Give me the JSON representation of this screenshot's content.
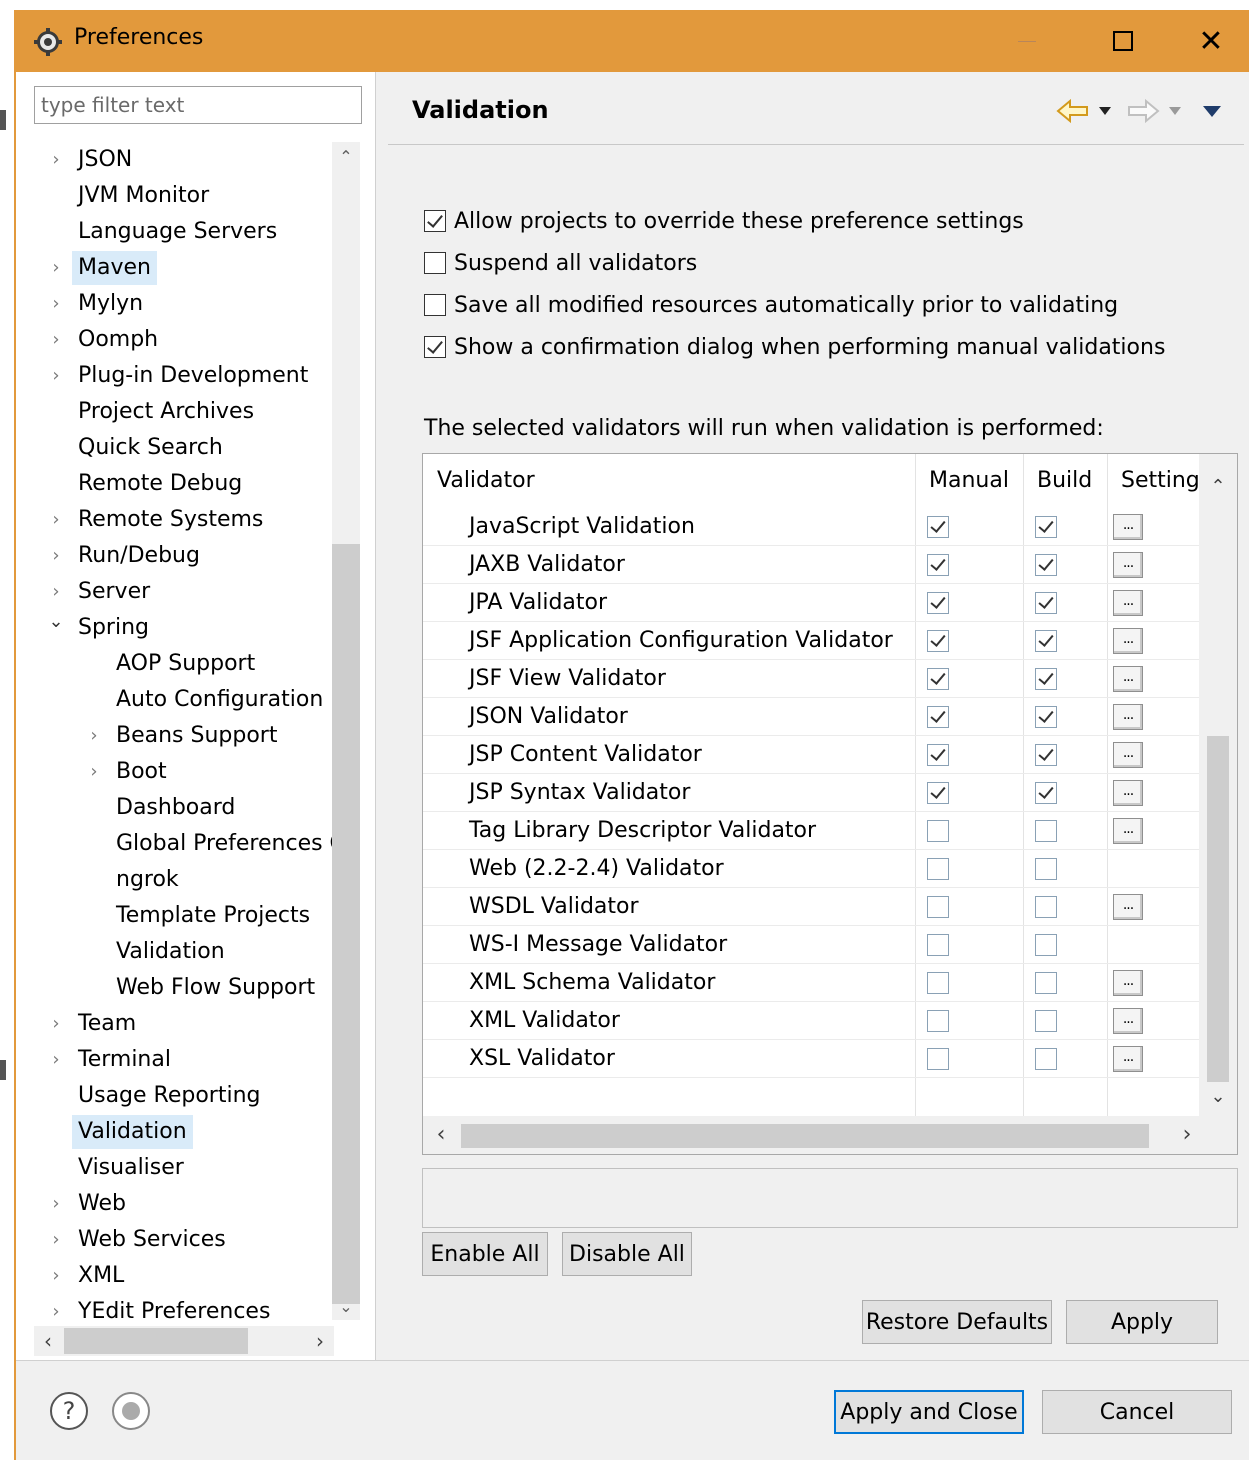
{
  "window": {
    "title": "Preferences",
    "title_icon": "gear-icon",
    "close_glyph": "✕"
  },
  "filter": {
    "placeholder": "type filter text",
    "value": ""
  },
  "tree": {
    "items": [
      {
        "label": "JSON",
        "level": 0,
        "expander": "collapsed",
        "selected": false
      },
      {
        "label": "JVM Monitor",
        "level": 0,
        "expander": "none",
        "selected": false
      },
      {
        "label": "Language Servers",
        "level": 0,
        "expander": "none",
        "selected": false
      },
      {
        "label": "Maven",
        "level": 0,
        "expander": "collapsed",
        "selected": true
      },
      {
        "label": "Mylyn",
        "level": 0,
        "expander": "collapsed",
        "selected": false
      },
      {
        "label": "Oomph",
        "level": 0,
        "expander": "collapsed",
        "selected": false
      },
      {
        "label": "Plug-in Development",
        "level": 0,
        "expander": "collapsed",
        "selected": false
      },
      {
        "label": "Project Archives",
        "level": 0,
        "expander": "none",
        "selected": false
      },
      {
        "label": "Quick Search",
        "level": 0,
        "expander": "none",
        "selected": false
      },
      {
        "label": "Remote Debug",
        "level": 0,
        "expander": "none",
        "selected": false
      },
      {
        "label": "Remote Systems",
        "level": 0,
        "expander": "collapsed",
        "selected": false
      },
      {
        "label": "Run/Debug",
        "level": 0,
        "expander": "collapsed",
        "selected": false
      },
      {
        "label": "Server",
        "level": 0,
        "expander": "collapsed",
        "selected": false
      },
      {
        "label": "Spring",
        "level": 0,
        "expander": "expanded",
        "selected": false
      },
      {
        "label": "AOP Support",
        "level": 1,
        "expander": "none",
        "selected": false
      },
      {
        "label": "Auto Configuration",
        "level": 1,
        "expander": "none",
        "selected": false
      },
      {
        "label": "Beans Support",
        "level": 1,
        "expander": "collapsed",
        "selected": false
      },
      {
        "label": "Boot",
        "level": 1,
        "expander": "collapsed",
        "selected": false
      },
      {
        "label": "Dashboard",
        "level": 1,
        "expander": "none",
        "selected": false
      },
      {
        "label": "Global Preferences C",
        "level": 1,
        "expander": "none",
        "selected": false
      },
      {
        "label": "ngrok",
        "level": 1,
        "expander": "none",
        "selected": false
      },
      {
        "label": "Template Projects",
        "level": 1,
        "expander": "none",
        "selected": false
      },
      {
        "label": "Validation",
        "level": 1,
        "expander": "none",
        "selected": false
      },
      {
        "label": "Web Flow Support",
        "level": 1,
        "expander": "none",
        "selected": false
      },
      {
        "label": "Team",
        "level": 0,
        "expander": "collapsed",
        "selected": false
      },
      {
        "label": "Terminal",
        "level": 0,
        "expander": "collapsed",
        "selected": false
      },
      {
        "label": "Usage Reporting",
        "level": 0,
        "expander": "none",
        "selected": false
      },
      {
        "label": "Validation",
        "level": 0,
        "expander": "none",
        "selected": true
      },
      {
        "label": "Visualiser",
        "level": 0,
        "expander": "none",
        "selected": false
      },
      {
        "label": "Web",
        "level": 0,
        "expander": "collapsed",
        "selected": false
      },
      {
        "label": "Web Services",
        "level": 0,
        "expander": "collapsed",
        "selected": false
      },
      {
        "label": "XML",
        "level": 0,
        "expander": "collapsed",
        "selected": false
      },
      {
        "label": "YEdit Preferences",
        "level": 0,
        "expander": "collapsed",
        "selected": false
      }
    ]
  },
  "page": {
    "title": "Validation",
    "nav": {
      "back_icon": "back-arrow-icon",
      "forward_icon": "forward-arrow-icon",
      "menu_icon": "view-menu-icon"
    }
  },
  "options": [
    {
      "label": "Allow projects to override these preference settings",
      "checked": true
    },
    {
      "label": "Suspend all validators",
      "checked": false
    },
    {
      "label": "Save all modified resources automatically prior to validating",
      "checked": false
    },
    {
      "label": "Show a confirmation dialog when performing manual validations",
      "checked": true
    }
  ],
  "validators": {
    "section_label": "The selected validators will run when validation is performed:",
    "columns": {
      "validator": "Validator",
      "manual": "Manual",
      "build": "Build",
      "settings": "Settings"
    },
    "settings_button_label": "...",
    "rows": [
      {
        "name": "JavaScript Validation",
        "manual": true,
        "build": true,
        "has_settings": true
      },
      {
        "name": "JAXB Validator",
        "manual": true,
        "build": true,
        "has_settings": true
      },
      {
        "name": "JPA Validator",
        "manual": true,
        "build": true,
        "has_settings": true
      },
      {
        "name": "JSF Application Configuration Validator",
        "manual": true,
        "build": true,
        "has_settings": true
      },
      {
        "name": "JSF View Validator",
        "manual": true,
        "build": true,
        "has_settings": true
      },
      {
        "name": "JSON Validator",
        "manual": true,
        "build": true,
        "has_settings": true
      },
      {
        "name": "JSP Content Validator",
        "manual": true,
        "build": true,
        "has_settings": true
      },
      {
        "name": "JSP Syntax Validator",
        "manual": true,
        "build": true,
        "has_settings": true
      },
      {
        "name": "Tag Library Descriptor Validator",
        "manual": false,
        "build": false,
        "has_settings": true
      },
      {
        "name": "Web (2.2-2.4) Validator",
        "manual": false,
        "build": false,
        "has_settings": false
      },
      {
        "name": "WSDL Validator",
        "manual": false,
        "build": false,
        "has_settings": true
      },
      {
        "name": "WS-I Message Validator",
        "manual": false,
        "build": false,
        "has_settings": false
      },
      {
        "name": "XML Schema Validator",
        "manual": false,
        "build": false,
        "has_settings": true
      },
      {
        "name": "XML Validator",
        "manual": false,
        "build": false,
        "has_settings": true
      },
      {
        "name": "XSL Validator",
        "manual": false,
        "build": false,
        "has_settings": true
      }
    ]
  },
  "buttons": {
    "enable_all": "Enable All",
    "disable_all": "Disable All",
    "restore_defaults": "Restore Defaults",
    "apply": "Apply",
    "apply_and_close": "Apply and Close",
    "cancel": "Cancel"
  },
  "footer": {
    "help_icon": "help-icon",
    "record_icon": "record-macro-icon",
    "help_glyph": "?"
  },
  "colors": {
    "titlebar": "#e2993c",
    "selection": "#d9ebf9",
    "default_button_border": "#0078d7"
  }
}
